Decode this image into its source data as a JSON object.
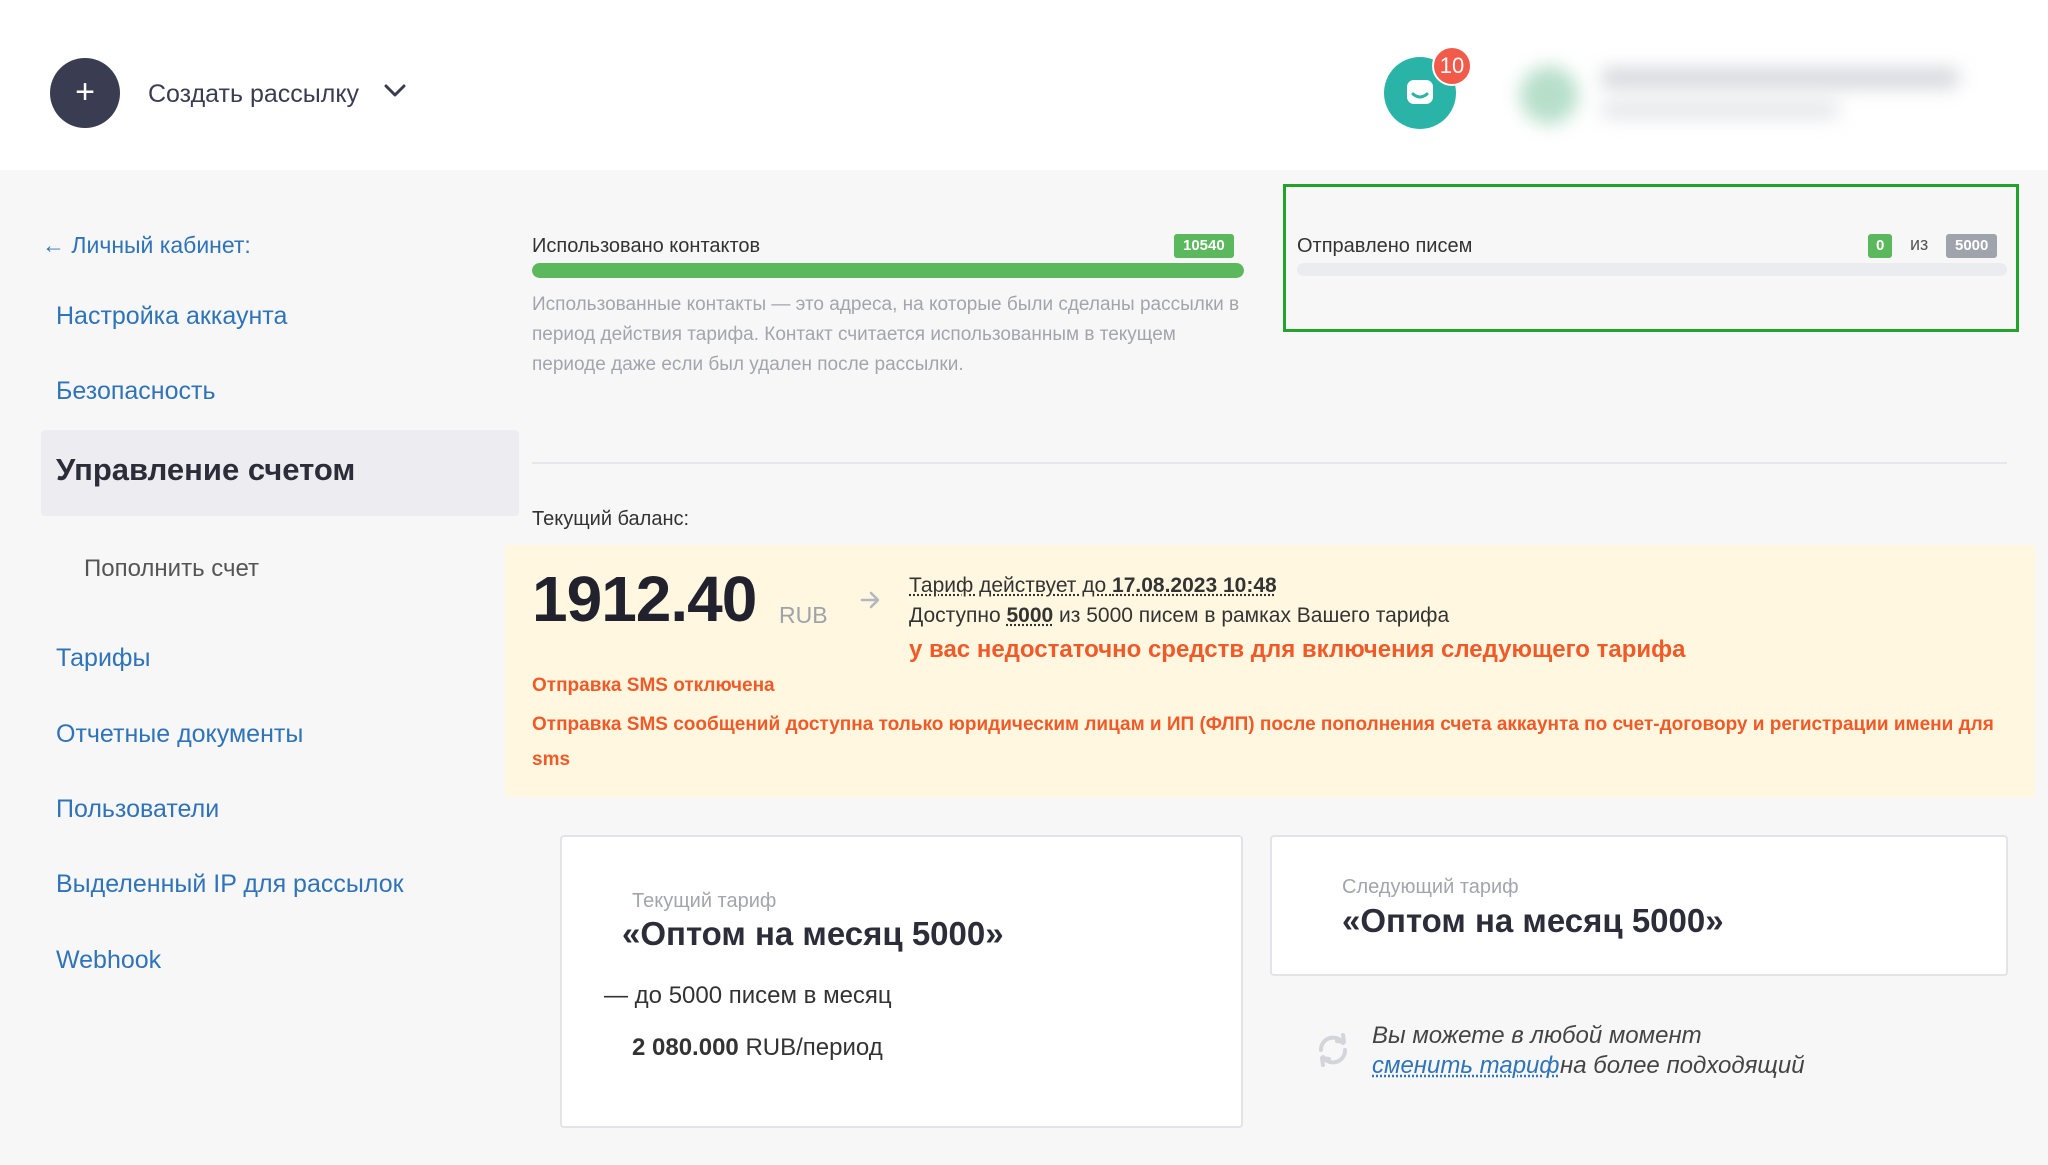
{
  "header": {
    "create_icon": "plus-icon",
    "create_label": "Создать рассылку",
    "notifications_count": "10",
    "notifications_icon": "chat-icon"
  },
  "sidebar": {
    "back_label": "← Личный кабинет:",
    "items": [
      "Настройка аккаунта",
      "Безопасность",
      "Управление счетом",
      "Пополнить счет",
      "Тарифы",
      "Отчетные документы",
      "Пользователи",
      "Выделенный IP для рассылок",
      "Webhook"
    ]
  },
  "contacts": {
    "label": "Использовано контактов",
    "count": "10540",
    "fill_percent": 100,
    "description": "Использованные контакты — это адреса, на которые были сделаны рассылки в период действия тарифа. Контакт считается использованным в текущем периоде даже если был удален после рассылки."
  },
  "letters": {
    "label": "Отправлено писем",
    "sent": "0",
    "of": "из",
    "total": "5000",
    "fill_percent": 0
  },
  "balance": {
    "label": "Текущий баланс:",
    "amount": "1912.40",
    "currency": "RUB",
    "tariff_until_prefix": "Тариф действует до ",
    "tariff_until_date": "17.08.2023 10:48",
    "available_prefix": "Доступно ",
    "available_count": "5000",
    "available_suffix": " из 5000 писем в рамках Вашего тарифа",
    "insufficient_warning": "у вас недостаточно средств для включения следующего тарифа",
    "sms_disabled": "Отправка SMS отключена",
    "sms_note": "Отправка SMS сообщений доступна только юридическим лицам и ИП (ФЛП) после пополнения счета аккаунта по счет-договору и регистрации имени для sms"
  },
  "current_tariff": {
    "caption": "Текущий тариф",
    "name": "«Оптом на месяц 5000»",
    "limit": "— до 5000 писем в месяц",
    "price_value": "2 080.000",
    "price_unit": " RUB/период"
  },
  "next_tariff": {
    "caption": "Следующий тариф",
    "name": "«Оптом на месяц 5000»"
  },
  "change_tariff": {
    "line1": "Вы можете в любой момент",
    "link": "сменить тариф",
    "rest": " на более подходящий"
  },
  "colors": {
    "accent_green": "#5cb85c",
    "warning_orange": "#f05a28",
    "link_blue": "#2f73b8",
    "highlight_border": "#22a32a",
    "balance_bg": "#fff7df"
  }
}
